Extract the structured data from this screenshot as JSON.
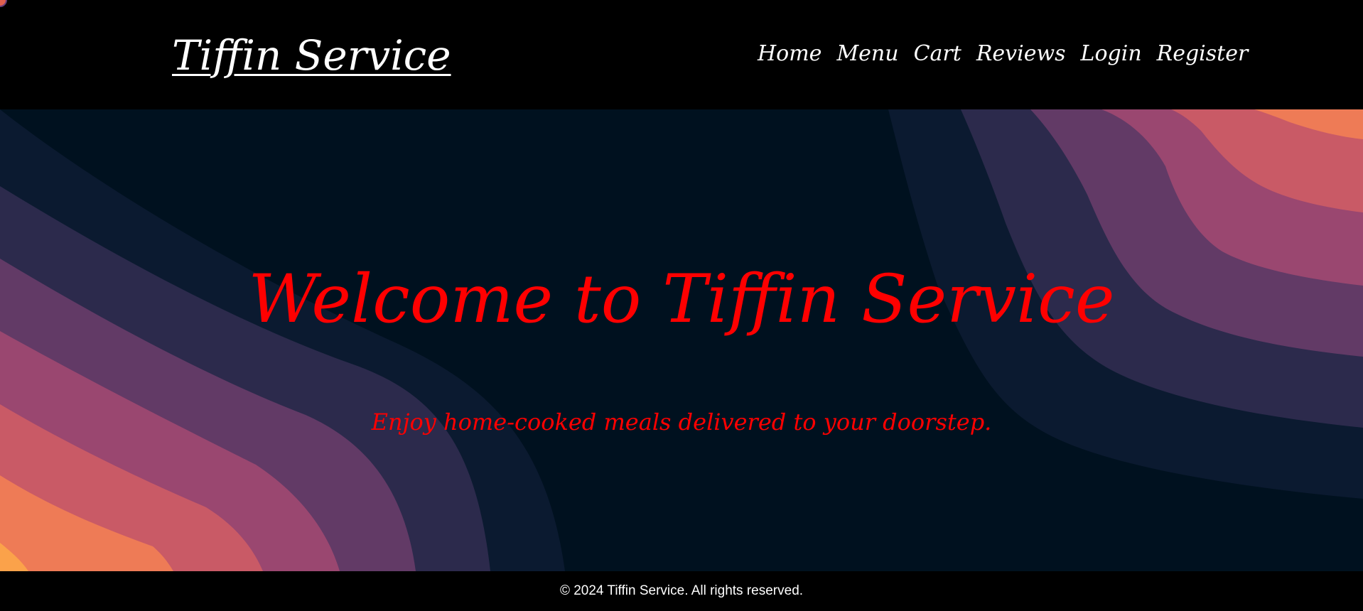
{
  "header": {
    "brand": "Tiffin Service",
    "nav": [
      "Home",
      "Menu",
      "Cart",
      "Reviews",
      "Login",
      "Register"
    ]
  },
  "hero": {
    "title": "Welcome to Tiffin Service",
    "subtitle": "Enjoy home-cooked meals delivered to your doorstep."
  },
  "footer": {
    "text": "© 2024 Tiffin Service. All rights reserved."
  },
  "colors": {
    "header_bg": "#000000",
    "hero_bg": "#00111f",
    "hero_text": "#ff0000",
    "nav_text": "#ffffff",
    "wave_palette": [
      "#0b1a30",
      "#2c2a4c",
      "#623a66",
      "#9a4770",
      "#c95a66",
      "#ee7b56",
      "#fba24a"
    ]
  }
}
